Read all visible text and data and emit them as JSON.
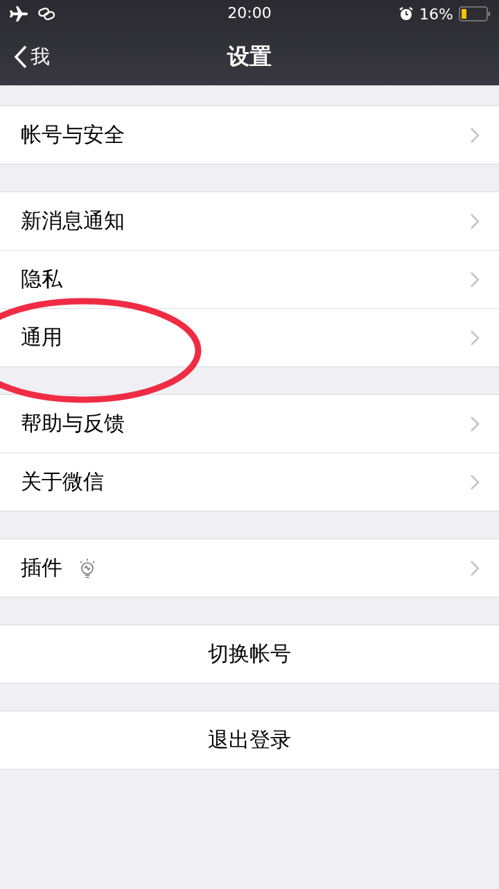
{
  "status_bar": {
    "time": "20:00",
    "battery": "16%"
  },
  "nav_bar": {
    "back": "我",
    "title": "设置"
  },
  "groups": [
    [
      {
        "kind": "link",
        "label": "帐号与安全",
        "highlighted": false
      }
    ],
    [
      {
        "kind": "link",
        "label": "新消息通知",
        "highlighted": false
      },
      {
        "kind": "link",
        "label": "隐私",
        "highlighted": false
      },
      {
        "kind": "link",
        "label": "通用",
        "highlighted": true
      }
    ],
    [
      {
        "kind": "link",
        "label": "帮助与反馈",
        "highlighted": false
      },
      {
        "kind": "link",
        "label": "关于微信",
        "highlighted": false
      }
    ],
    [
      {
        "kind": "link-icon",
        "label": "插件",
        "highlighted": false
      }
    ],
    [
      {
        "kind": "action",
        "label": "切换帐号",
        "highlighted": false
      }
    ],
    [
      {
        "kind": "action",
        "label": "退出登录",
        "highlighted": false
      }
    ]
  ]
}
